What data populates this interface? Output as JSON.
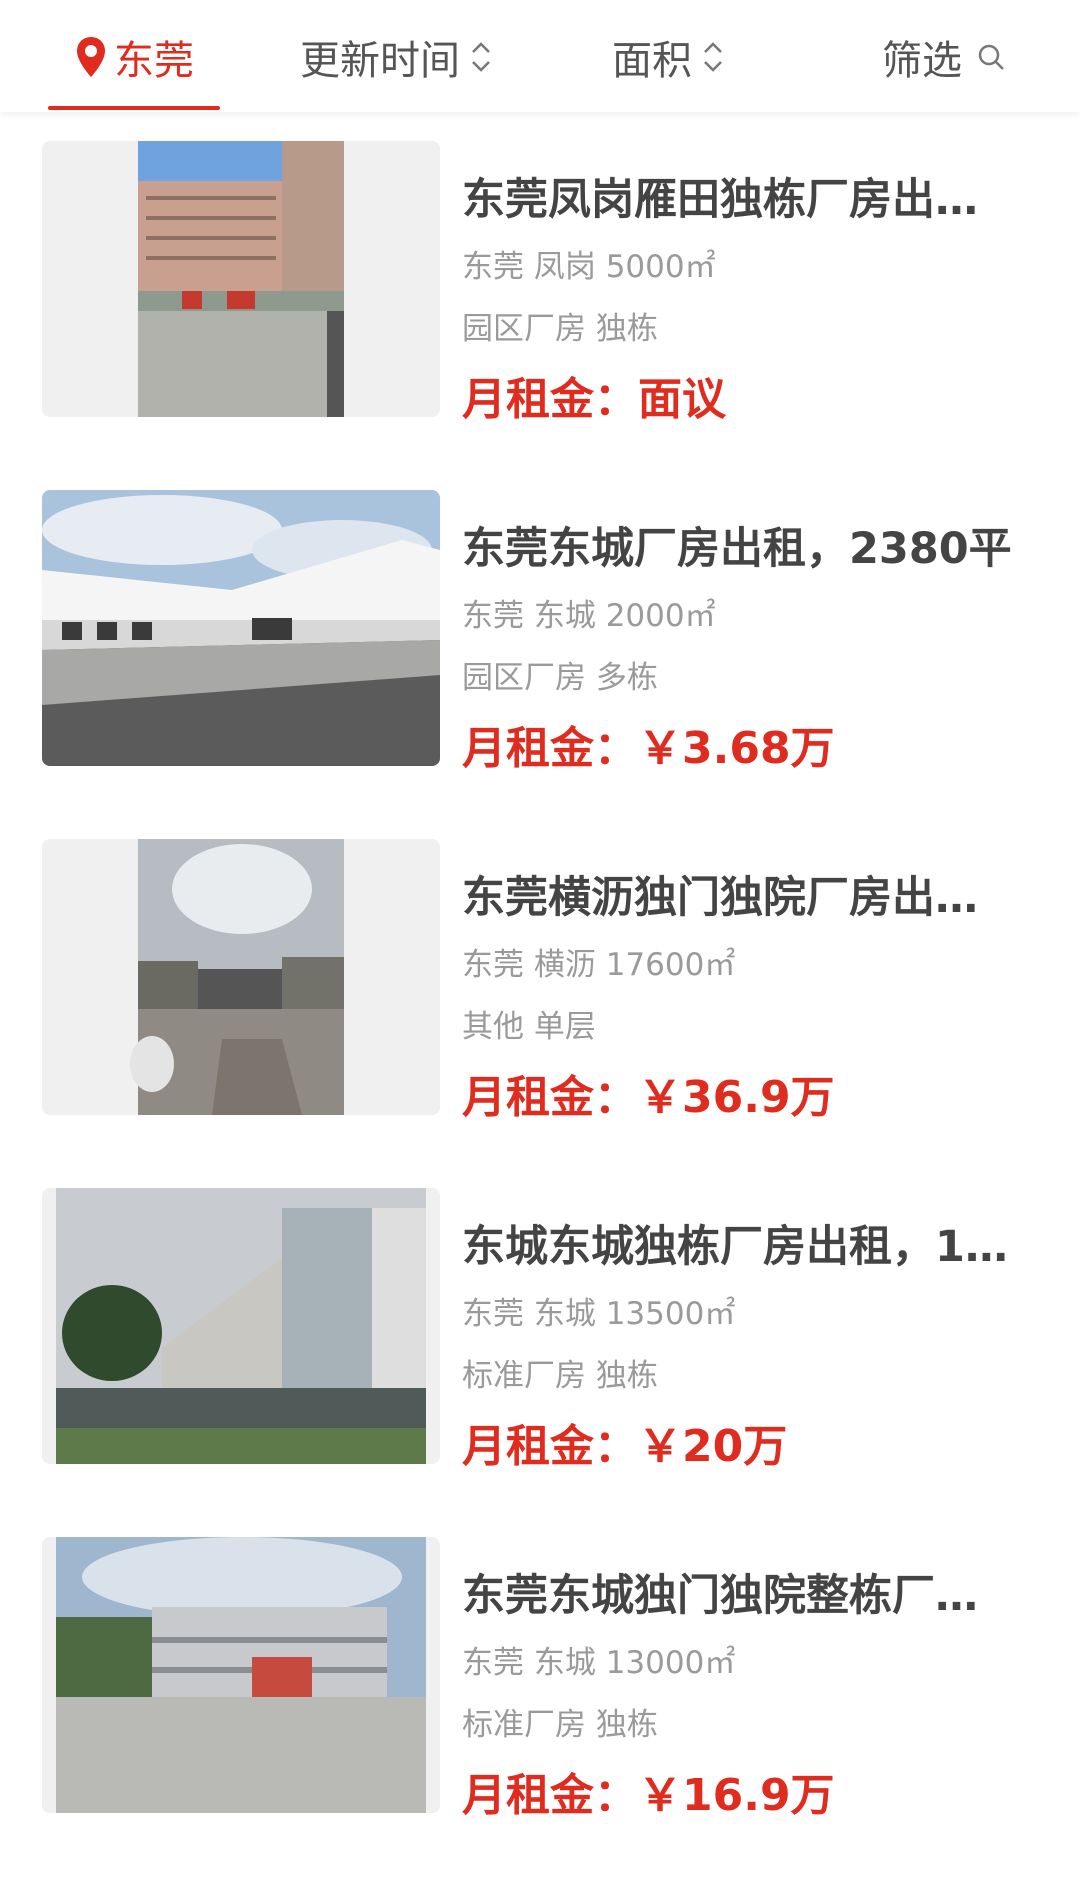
{
  "tabs": {
    "city": "东莞",
    "update_time": "更新时间",
    "area": "面积",
    "filter": "筛选"
  },
  "colors": {
    "accent": "#e02b1f",
    "title": "#444444",
    "meta": "#9a9a9a"
  },
  "rent_label": "月租金：",
  "listings": [
    {
      "title": "东莞凤岗雁田独栋厂房出…",
      "location": "东莞 凤岗 5000㎡",
      "type": "园区厂房 独栋",
      "rent": "面议",
      "image": "building-photo"
    },
    {
      "title": "东莞东城厂房出租，2380平",
      "location": "东莞 东城 2000㎡",
      "type": "园区厂房 多栋",
      "rent": "￥3.68万",
      "image": "building-photo"
    },
    {
      "title": "东莞横沥独门独院厂房出…",
      "location": "东莞 横沥 17600㎡",
      "type": "其他 单层",
      "rent": "￥36.9万",
      "image": "building-photo"
    },
    {
      "title": "东城东城独栋厂房出租，1…",
      "location": "东莞 东城 13500㎡",
      "type": "标准厂房 独栋",
      "rent": "￥20万",
      "image": "building-photo"
    },
    {
      "title": "东莞东城独门独院整栋厂…",
      "location": "东莞 东城 13000㎡",
      "type": "标准厂房 独栋",
      "rent": "￥16.9万",
      "image": "building-photo"
    }
  ]
}
